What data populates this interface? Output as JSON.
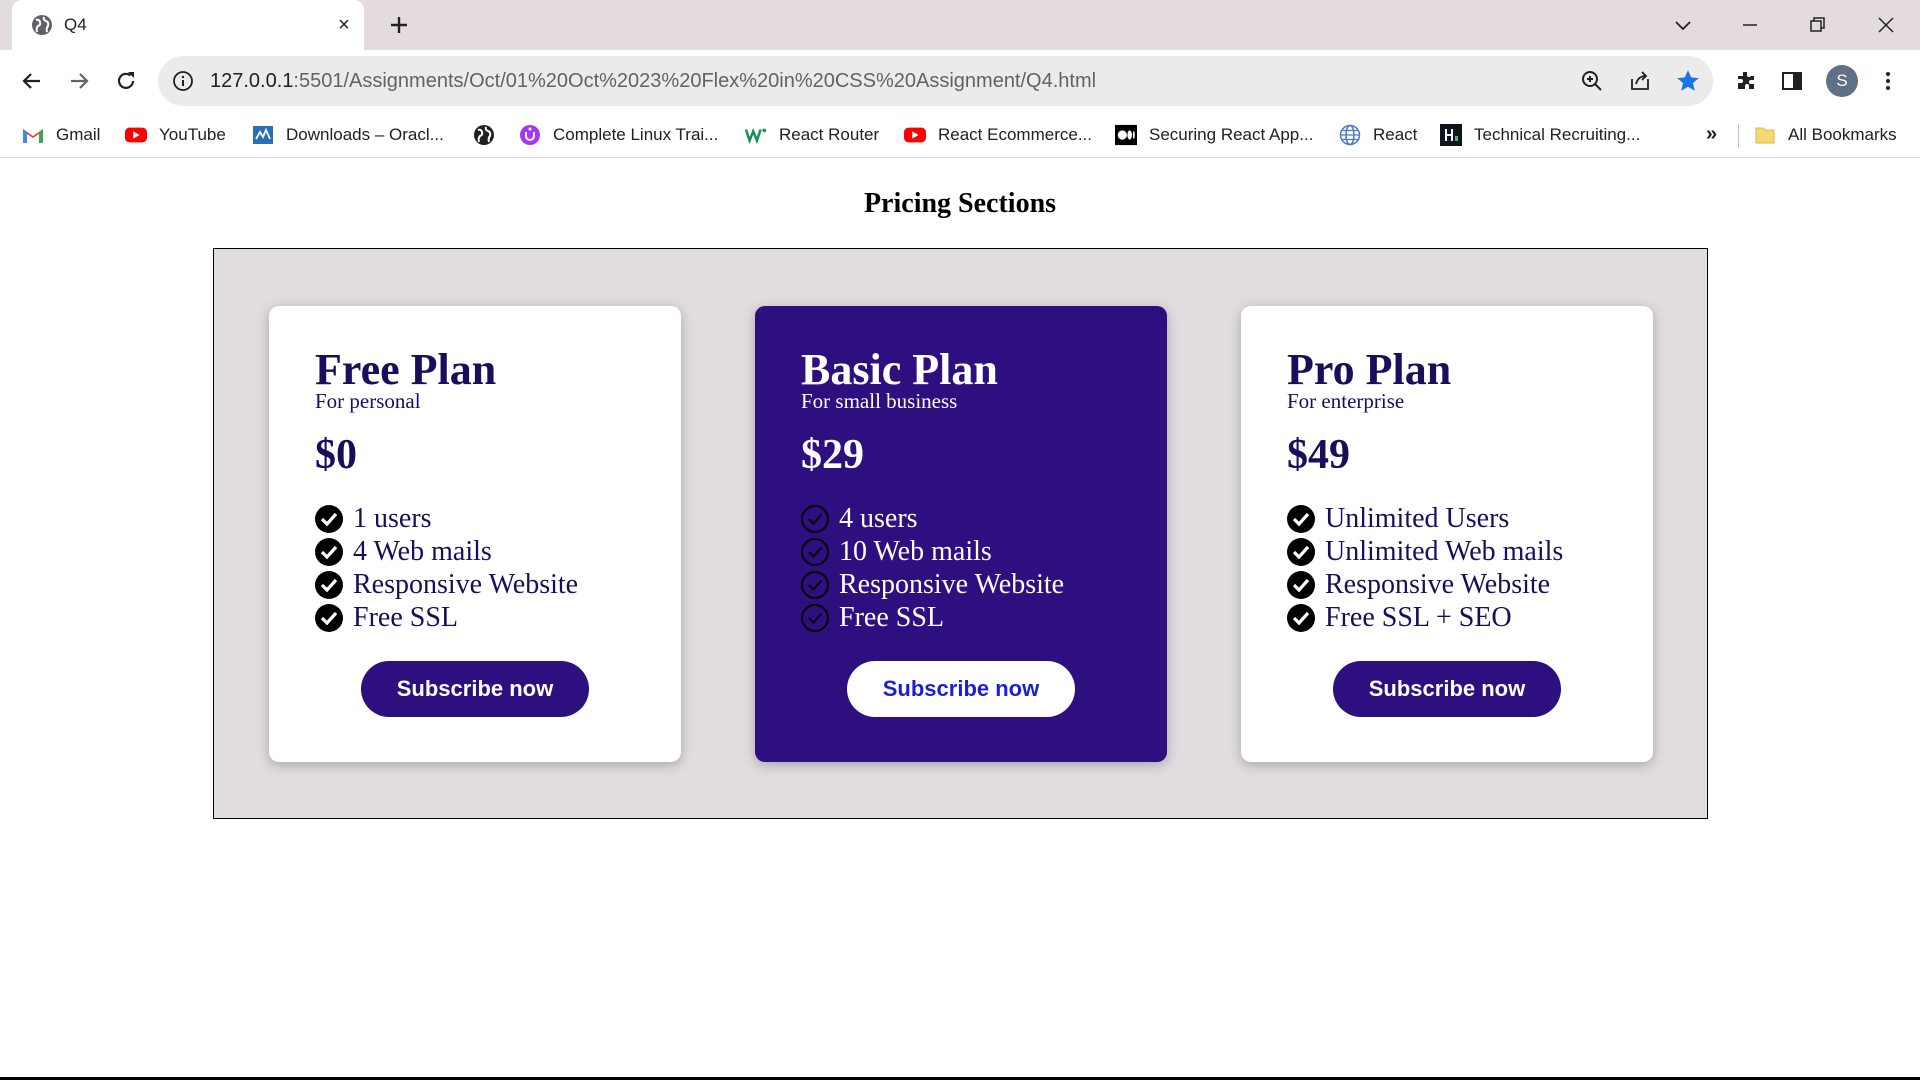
{
  "browser": {
    "tab_title": "Q4",
    "tab_close": "×",
    "url_host": "127.0.0.1",
    "url_rest": ":5501/Assignments/Oct/01%20Oct%2023%20Flex%20in%20CSS%20Assignment/Q4.html",
    "avatar_letter": "S",
    "accent_color": "#1a73e8"
  },
  "bookmarks": [
    {
      "label": "Gmail",
      "icon": "gmail-icon"
    },
    {
      "label": "YouTube",
      "icon": "youtube-icon"
    },
    {
      "label": "Downloads – Oracl...",
      "icon": "oracle-icon"
    },
    {
      "label": "",
      "icon": "globe-icon"
    },
    {
      "label": "Complete Linux Trai...",
      "icon": "udemy-icon"
    },
    {
      "label": "React Router",
      "icon": "webflow-icon"
    },
    {
      "label": "React Ecommerce...",
      "icon": "youtube-icon"
    },
    {
      "label": "Securing React App...",
      "icon": "medium-icon"
    },
    {
      "label": "React",
      "icon": "globe-icon"
    },
    {
      "label": "Technical Recruiting...",
      "icon": "hackerrank-icon"
    }
  ],
  "bookmarks_more": "»",
  "all_bookmarks": "All Bookmarks",
  "page": {
    "title": "Pricing Sections"
  },
  "plans": [
    {
      "name": "Free Plan",
      "subtitle": "For personal",
      "price": "$0",
      "features": [
        "1 users",
        "4 Web mails",
        "Responsive Website",
        "Free SSL"
      ],
      "button": "Subscribe now",
      "featured": false
    },
    {
      "name": "Basic Plan",
      "subtitle": "For small business",
      "price": "$29",
      "features": [
        "4 users",
        "10 Web mails",
        "Responsive Website",
        "Free SSL"
      ],
      "button": "Subscribe now",
      "featured": true
    },
    {
      "name": "Pro Plan",
      "subtitle": "For enterprise",
      "price": "$49",
      "features": [
        "Unlimited Users",
        "Unlimited Web mails",
        "Responsive Website",
        "Free SSL + SEO"
      ],
      "button": "Subscribe now",
      "featured": false
    }
  ],
  "colors": {
    "featured_card": "#2d0f80",
    "card_text": "#1a0e5c",
    "container_bg": "#e0dce0",
    "featured_button_text": "#1a1fd4"
  }
}
